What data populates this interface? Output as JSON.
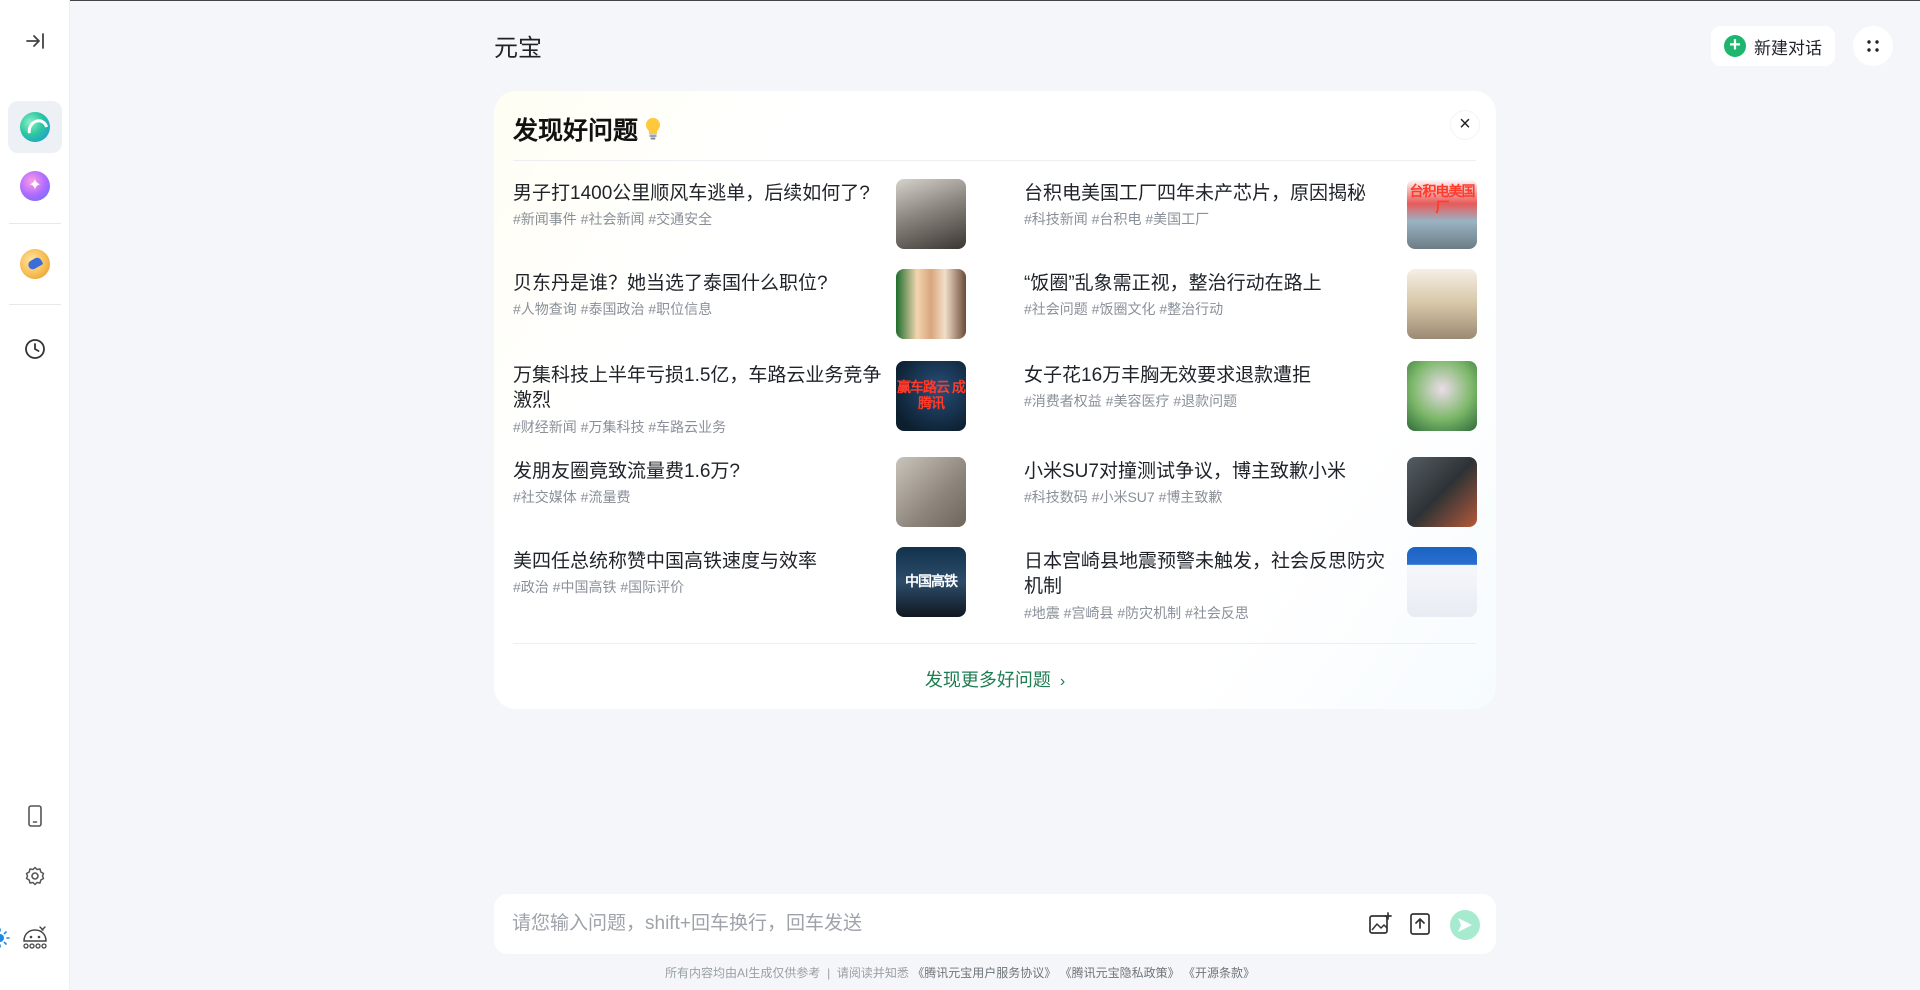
{
  "app": {
    "title": "元宝",
    "new_chat_label": "新建对话"
  },
  "sidebar": {
    "items": [
      {
        "name": "expand-sidebar-icon"
      },
      {
        "name": "yuanbao-agent-icon"
      },
      {
        "name": "ai-spark-agent-icon"
      },
      {
        "name": "painting-agent-icon"
      },
      {
        "name": "history-clock-icon"
      },
      {
        "name": "mobile-phone-icon"
      },
      {
        "name": "settings-gear-icon"
      },
      {
        "name": "theme-toggle-icon"
      },
      {
        "name": "user-avatar-icon"
      }
    ]
  },
  "discover": {
    "title": "发现好问题",
    "more_label": "发现更多好问题",
    "items": [
      {
        "question": "男子打1400公里顺风车逃单，后续如何了?",
        "tags": "#新闻事件 #社会新闻 #交通安全"
      },
      {
        "question": "台积电美国工厂四年未产芯片，原因揭秘",
        "tags": "#科技新闻 #台积电 #美国工厂",
        "thumb_text": "台积电美国厂"
      },
      {
        "question": "贝东丹是谁？她当选了泰国什么职位?",
        "tags": "#人物查询 #泰国政治 #职位信息"
      },
      {
        "question": "“饭圈”乱象需正视，整治行动在路上",
        "tags": "#社会问题 #饭圈文化 #整治行动"
      },
      {
        "question": "万集科技上半年亏损1.5亿，车路云业务竞争激烈",
        "tags": "#财经新闻 #万集科技 #车路云业务",
        "thumb_text": "赢车路云 成腾讯"
      },
      {
        "question": "女子花16万丰胸无效要求退款遭拒",
        "tags": "#消费者权益 #美容医疗 #退款问题"
      },
      {
        "question": "发朋友圈竟致流量费1.6万?",
        "tags": "#社交媒体 #流量费"
      },
      {
        "question": "小米SU7对撞测试争议，博主致歉小米",
        "tags": "#科技数码 #小米SU7 #博主致歉"
      },
      {
        "question": "美四任总统称赞中国高铁速度与效率",
        "tags": "#政治 #中国高铁 #国际评价",
        "thumb_text": "中国高铁"
      },
      {
        "question": "日本宫崎县地震预警未触发，社会反思防灾机制",
        "tags": "#地震 #宫崎县 #防灾机制 #社会反思"
      }
    ]
  },
  "composer": {
    "placeholder": "请您输入问题，shift+回车换行，回车发送"
  },
  "footer": {
    "disclaimer": "所有内容均由AI生成仅供参考",
    "separator": "|",
    "read_prefix": "请阅读并知悉",
    "links": [
      "《腾讯元宝用户服务协议》",
      "《腾讯元宝隐私政策》",
      "《开源条款》"
    ]
  },
  "colors": {
    "accent": "#1eb56d",
    "link": "#1e7e52",
    "send_disabled": "#a6ead0"
  }
}
